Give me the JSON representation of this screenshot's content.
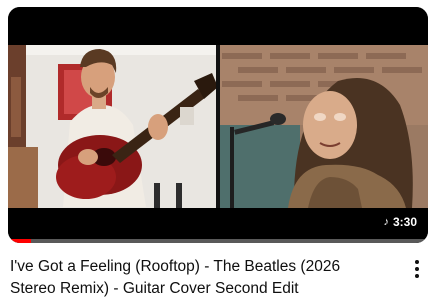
{
  "video": {
    "title": "I've Got a Feeling (Rooftop) - The Beatles (2026 Stereo Remix) - Guitar Cover Second Edit",
    "duration": "3:30",
    "duration_icon": "music-note-icon",
    "watch_progress": 0.055,
    "menu_icon": "more-vert-icon"
  },
  "colors": {
    "progress": "#ff0000",
    "title_text": "#0f0f0f",
    "duration_bg": "#000000"
  }
}
